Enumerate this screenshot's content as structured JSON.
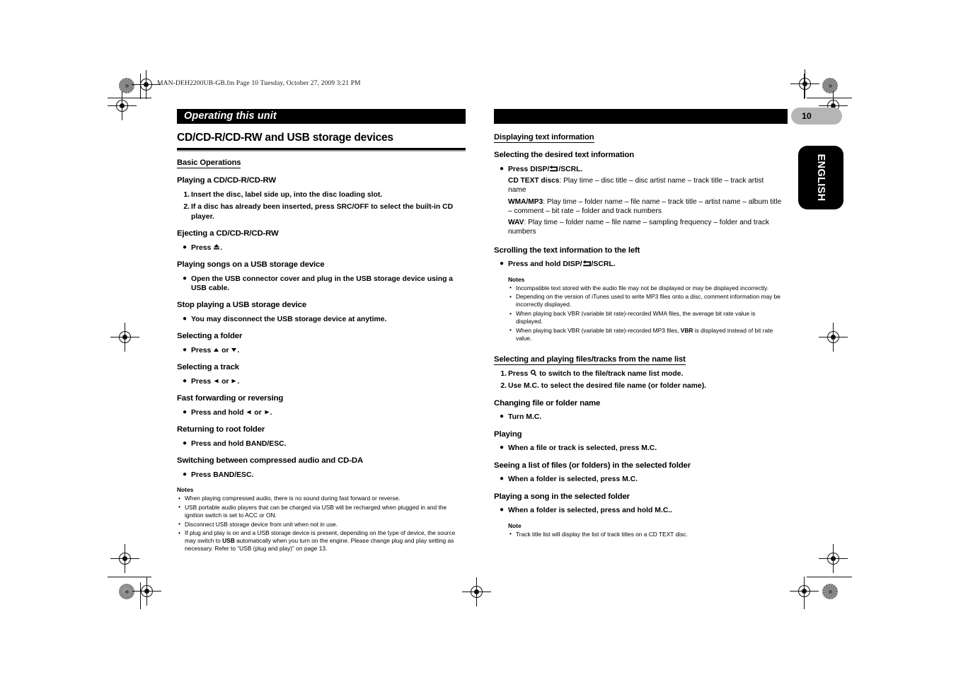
{
  "running_header": "MAN-DEH2200UB-GB.fm  Page 10  Tuesday, October 27, 2009  3:21 PM",
  "page_number": "10",
  "language_tab": "ENGLISH",
  "left_column": {
    "banner": "Operating this unit",
    "section_title": "CD/CD-R/CD-RW and USB storage devices",
    "subsection": "Basic Operations",
    "blocks": [
      {
        "heading": "Playing a CD/CD-R/CD-RW",
        "steps": [
          {
            "num": "1.",
            "text": "Insert the disc, label side up, into the disc loading slot."
          },
          {
            "num": "2.",
            "text": "If a disc has already been inserted, press SRC/OFF to select the built-in CD player."
          }
        ]
      },
      {
        "heading": "Ejecting a CD/CD-R/CD-RW",
        "bullet_pre": "Press ",
        "bullet_icon": "eject-icon",
        "bullet_post": "."
      },
      {
        "heading": "Playing songs on a USB storage device",
        "bullet": "Open the USB connector cover and plug in the USB storage device using a USB cable."
      },
      {
        "heading": "Stop playing a USB storage device",
        "bullet": "You may disconnect the USB storage device at anytime."
      },
      {
        "heading": "Selecting a folder",
        "bullet_pre": "Press ",
        "bullet_icon": "triangle-up-icon",
        "bullet_mid": " or ",
        "bullet_icon2": "triangle-down-icon",
        "bullet_post": "."
      },
      {
        "heading": "Selecting a track",
        "bullet_pre": "Press ",
        "bullet_icon": "triangle-left-icon",
        "bullet_mid": " or ",
        "bullet_icon2": "triangle-right-icon",
        "bullet_post": "."
      },
      {
        "heading": "Fast forwarding or reversing",
        "bullet_pre": "Press and hold ",
        "bullet_icon": "triangle-left-icon",
        "bullet_mid": " or ",
        "bullet_icon2": "triangle-right-icon",
        "bullet_post": "."
      },
      {
        "heading": "Returning to root folder",
        "bullet": "Press and hold BAND/ESC."
      },
      {
        "heading": "Switching between compressed audio and CD-DA",
        "bullet": "Press BAND/ESC."
      }
    ],
    "notes": {
      "title": "Notes",
      "items": [
        "When playing compressed audio, there is no sound during fast forward or reverse.",
        "USB portable audio players that can be charged via USB will be recharged when plugged in and the ignition switch is set to ACC or ON.",
        "Disconnect USB storage device from unit when not in use.",
        "If plug and play is on and a USB storage device is present, depending on the type of device, the source may switch to USB automatically when you turn on the engine. Please change plug and play setting as necessary. Refer to “USB (plug and play)” on page 13."
      ],
      "item4_bold": "USB",
      "item4_part1": "If plug and play is on and a USB storage device is present, depending on the type of device, the source may switch to ",
      "item4_part2": " automatically when you turn on the engine. Please change plug and play setting as necessary. Refer to “USB (plug and play)” on page 13."
    }
  },
  "right_column": {
    "banner": "",
    "subsection_1": "Displaying text information",
    "block_1": {
      "heading": "Selecting the desired text information",
      "bullet_pre": "Press DISP/",
      "bullet_icon": "return-arrow-icon",
      "bullet_post": "/SCRL.",
      "definitions": [
        {
          "term": "CD TEXT discs",
          "desc": ": Play time – disc title – disc artist name – track title – track artist name"
        },
        {
          "term": "WMA/MP3",
          "desc": ": Play time – folder name – file name – track title – artist name – album title – comment – bit rate – folder and track numbers"
        },
        {
          "term": "WAV",
          "desc": ": Play time – folder name – file name – sampling frequency – folder and track numbers"
        }
      ]
    },
    "block_2": {
      "heading": "Scrolling the text information to the left",
      "bullet_pre": "Press and hold DISP/",
      "bullet_icon": "return-arrow-icon",
      "bullet_post": "/SCRL.",
      "notes": {
        "title": "Notes",
        "items": [
          "Incompatible text stored with the audio file may not be displayed or may be displayed incorrectly.",
          "Depending on the version of iTunes used to write MP3 files onto a disc, comment information may be incorrectly displayed.",
          "When playing back VBR (variable bit rate)-recorded WMA files, the average bit rate value is displayed.",
          "When playing back VBR (variable bit rate)-recorded MP3 files, VBR is displayed instead of bit rate value."
        ],
        "item4_part1": "When playing back VBR (variable bit rate)-recorded MP3 files, ",
        "item4_bold": "VBR",
        "item4_part2": " is displayed instead of bit rate value."
      }
    },
    "subsection_2": "Selecting and playing files/tracks from the name list",
    "steps": [
      {
        "num": "1.",
        "pre": "Press ",
        "icon": "search-icon",
        "post": " to switch to the file/track name list mode."
      },
      {
        "num": "2.",
        "pre": "Use M.C. to select the desired file name (or folder name).",
        "icon": "",
        "post": ""
      }
    ],
    "blocks": [
      {
        "heading": "Changing file or folder name",
        "bullet": "Turn M.C."
      },
      {
        "heading": "Playing",
        "bullet": "When a file or track is selected, press M.C."
      },
      {
        "heading": "Seeing a list of files (or folders) in the selected folder",
        "bullet": "When a folder is selected, press M.C."
      },
      {
        "heading": "Playing a song in the selected folder",
        "bullet": "When a folder is selected, press and hold M.C.."
      }
    ],
    "note": {
      "title": "Note",
      "items": [
        "Track title list will display the list of track titles on a CD TEXT disc."
      ]
    }
  }
}
